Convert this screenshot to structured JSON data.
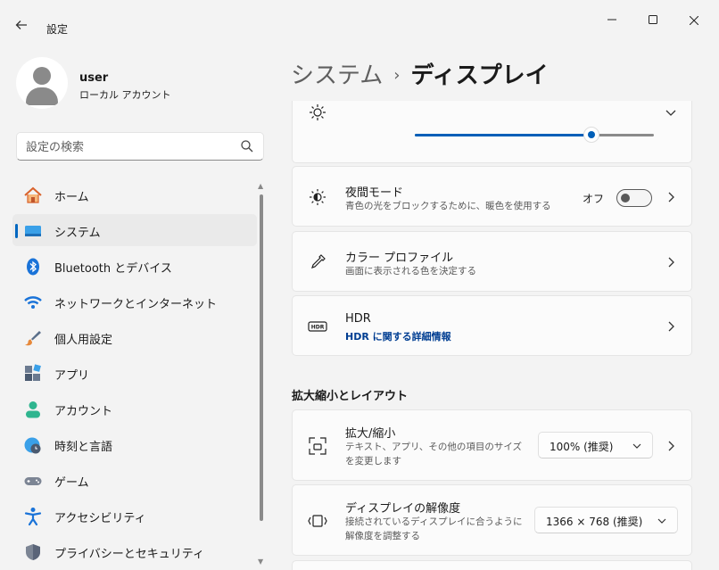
{
  "window": {
    "app_title": "設定",
    "controls": {
      "minimize": "–",
      "maximize": "☐",
      "close": "✕"
    }
  },
  "profile": {
    "name": "user",
    "account_type": "ローカル アカウント"
  },
  "search": {
    "placeholder": "設定の検索"
  },
  "sidebar": {
    "items": [
      {
        "label": "ホーム",
        "icon": "home-icon"
      },
      {
        "label": "システム",
        "icon": "system-icon",
        "active": true
      },
      {
        "label": "Bluetooth とデバイス",
        "icon": "bluetooth-icon"
      },
      {
        "label": "ネットワークとインターネット",
        "icon": "wifi-icon"
      },
      {
        "label": "個人用設定",
        "icon": "brush-icon"
      },
      {
        "label": "アプリ",
        "icon": "apps-icon"
      },
      {
        "label": "アカウント",
        "icon": "account-icon"
      },
      {
        "label": "時刻と言語",
        "icon": "globe-clock-icon"
      },
      {
        "label": "ゲーム",
        "icon": "gamepad-icon"
      },
      {
        "label": "アクセシビリティ",
        "icon": "accessibility-icon"
      },
      {
        "label": "プライバシーとセキュリティ",
        "icon": "shield-icon"
      }
    ]
  },
  "breadcrumb": {
    "parent": "システム",
    "separator": "›",
    "current": "ディスプレイ"
  },
  "brightness": {
    "level_percent": 74,
    "accent": "#005fb8"
  },
  "cards": {
    "night_light": {
      "title": "夜間モード",
      "subtitle": "青色の光をブロックするために、暖色を使用する",
      "state_label": "オフ"
    },
    "color_profile": {
      "title": "カラー プロファイル",
      "subtitle": "画面に表示される色を決定する"
    },
    "hdr": {
      "title": "HDR",
      "link": "HDR に関する詳細情報"
    }
  },
  "scale_layout": {
    "section_title": "拡大縮小とレイアウト",
    "scale": {
      "title": "拡大/縮小",
      "subtitle": "テキスト、アプリ、その他の項目のサイズを変更します",
      "value": "100% (推奨)"
    },
    "resolution": {
      "title": "ディスプレイの解像度",
      "subtitle": "接続されているディスプレイに合うように解像度を調整する",
      "value": "1366 × 768 (推奨)"
    }
  }
}
